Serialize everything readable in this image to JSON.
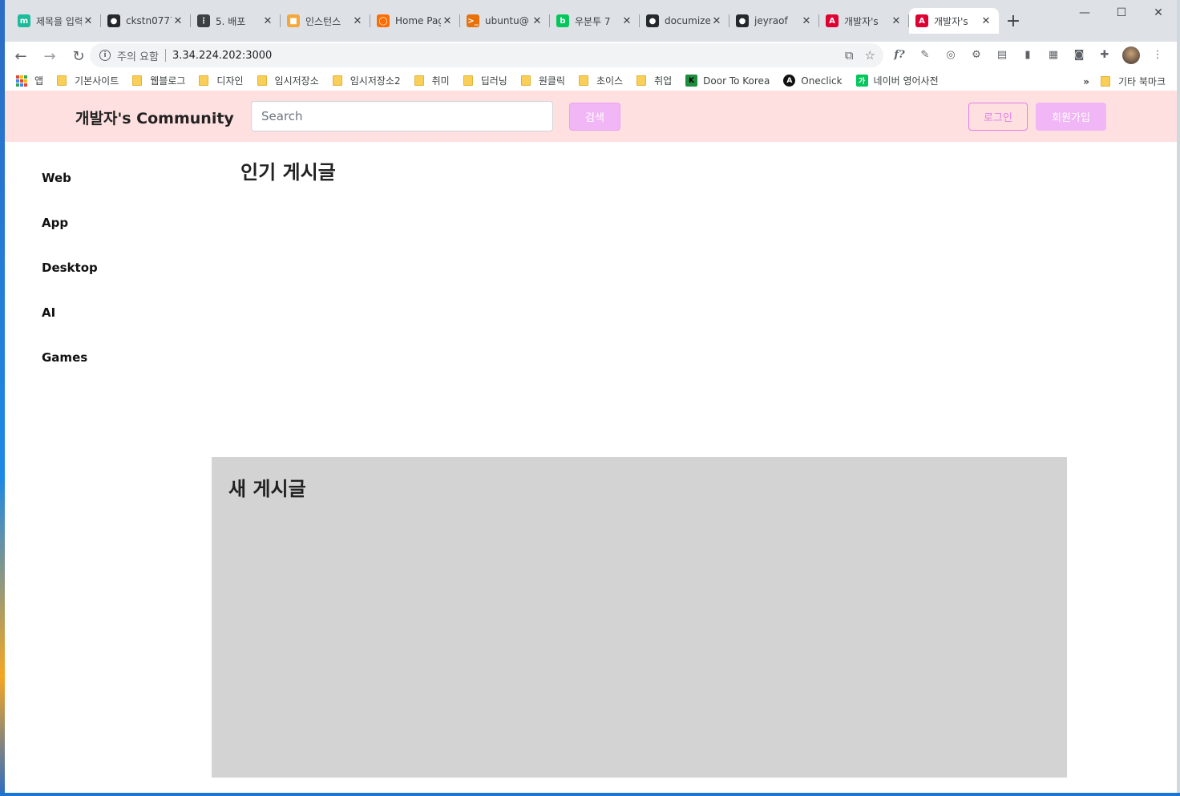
{
  "browser": {
    "tabs": [
      {
        "label": "제목을 입력",
        "favicon_color": "#1abc9c",
        "favicon_text": "m"
      },
      {
        "label": "ckstn0777",
        "favicon_color": "#24292e",
        "favicon_text": "●"
      },
      {
        "label": "5. 배포",
        "favicon_color": "#3c4043",
        "favicon_text": "⋮"
      },
      {
        "label": "인스턴스",
        "favicon_color": "#f4a83a",
        "favicon_text": "■"
      },
      {
        "label": "Home Page",
        "favicon_color": "#ff6d00",
        "favicon_text": "◯"
      },
      {
        "label": "ubuntu@",
        "favicon_color": "#e8710a",
        "favicon_text": ">_"
      },
      {
        "label": "우분투 7",
        "favicon_color": "#03c75a",
        "favicon_text": "b"
      },
      {
        "label": "documize",
        "favicon_color": "#24292e",
        "favicon_text": "●"
      },
      {
        "label": "jeyraof",
        "favicon_color": "#24292e",
        "favicon_text": "●"
      },
      {
        "label": "개발자's",
        "favicon_color": "#dd0031",
        "favicon_text": "A"
      },
      {
        "label": "개발자's",
        "favicon_color": "#dd0031",
        "favicon_text": "A"
      }
    ],
    "new_tab": "+",
    "window_controls": [
      "—",
      "☐",
      "✕"
    ],
    "address": {
      "security_label": "주의 요함",
      "url": "3.34.224.202:3000"
    },
    "bookmarks": {
      "apps_label": "앱",
      "folders": [
        "기본사이트",
        "웹블로그",
        "디자인",
        "임시저장소",
        "임시저장소2",
        "취미",
        "딥러닝",
        "원클릭",
        "초이스",
        "취업"
      ],
      "links": [
        "Door To Korea",
        "Oneclick",
        "네이버 영어사전"
      ],
      "more": "»",
      "other": "기타 북마크"
    }
  },
  "site": {
    "brand": "개발자's Community",
    "search_placeholder": "Search",
    "search_button": "검색",
    "login_button": "로그인",
    "signup_button": "회원가입",
    "categories": [
      "Web",
      "App",
      "Desktop",
      "AI",
      "Games"
    ],
    "popular_title": "인기 게시글",
    "new_title": "새 게시글"
  },
  "colors": {
    "navbar_bg": "#ffe0e0",
    "accent": "#f0b6f5",
    "accent_border": "#e07ee8",
    "panel_bg": "#d3d3d3"
  }
}
